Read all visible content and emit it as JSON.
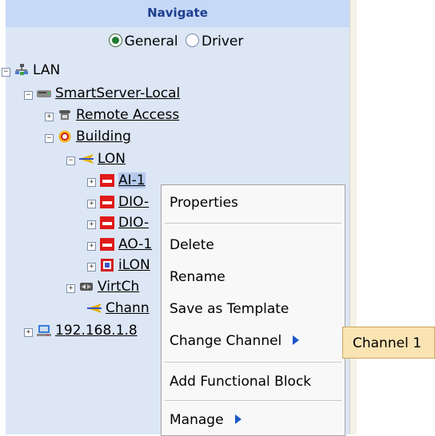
{
  "panel": {
    "title": "Navigate"
  },
  "mode": {
    "general": "General",
    "driver": "Driver",
    "selected": "General"
  },
  "tree": {
    "lan": "LAN",
    "server": "SmartServer-Local",
    "remote": "Remote Access",
    "building": "Building",
    "lon": "LON",
    "ai1": "AI-1",
    "dio1": "DIO-",
    "dio2": "DIO-",
    "ao1": "AO-1",
    "ilon": "iLON",
    "virtch": "VirtCh",
    "channel": "Chann",
    "ip": "192.168.1.8"
  },
  "menu": {
    "properties": "Properties",
    "delete": "Delete",
    "rename": "Rename",
    "save_template": "Save as Template",
    "change_channel": "Change Channel",
    "add_block": "Add Functional Block",
    "manage": "Manage"
  },
  "submenu": {
    "channel1": "Channel 1"
  },
  "colors": {
    "panel_bg": "#dce6f5",
    "header_bg": "#c6d9f7",
    "device_red": "#e01a1a",
    "submenu_bg": "#fae4b4",
    "arrow": "#1a57c7"
  }
}
